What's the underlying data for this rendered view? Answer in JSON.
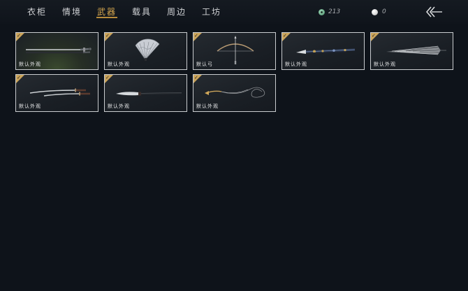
{
  "nav": {
    "tabs": [
      {
        "label": "衣柜",
        "active": false
      },
      {
        "label": "情境",
        "active": false
      },
      {
        "label": "武器",
        "active": true
      },
      {
        "label": "载具",
        "active": false
      },
      {
        "label": "周边",
        "active": false
      },
      {
        "label": "工坊",
        "active": false
      }
    ],
    "jade_amount": "213",
    "pearl_amount": "0",
    "accent_color": "#d6a74f"
  },
  "items": [
    {
      "label": "默认外观",
      "icon": "long-sword-icon",
      "equipped": true,
      "selected": true
    },
    {
      "label": "默认外观",
      "icon": "folding-fan-icon",
      "equipped": true,
      "selected": false
    },
    {
      "label": "默认弓",
      "icon": "bow-icon",
      "equipped": true,
      "selected": false
    },
    {
      "label": "默认外观",
      "icon": "ornate-spear-icon",
      "equipped": true,
      "selected": false
    },
    {
      "label": "默认外观",
      "icon": "umbrella-icon",
      "equipped": true,
      "selected": false
    },
    {
      "label": "默认外观",
      "icon": "twin-blades-icon",
      "equipped": true,
      "selected": false
    },
    {
      "label": "默认外观",
      "icon": "glaive-icon",
      "equipped": true,
      "selected": false
    },
    {
      "label": "默认外观",
      "icon": "rope-dart-icon",
      "equipped": true,
      "selected": false
    }
  ]
}
